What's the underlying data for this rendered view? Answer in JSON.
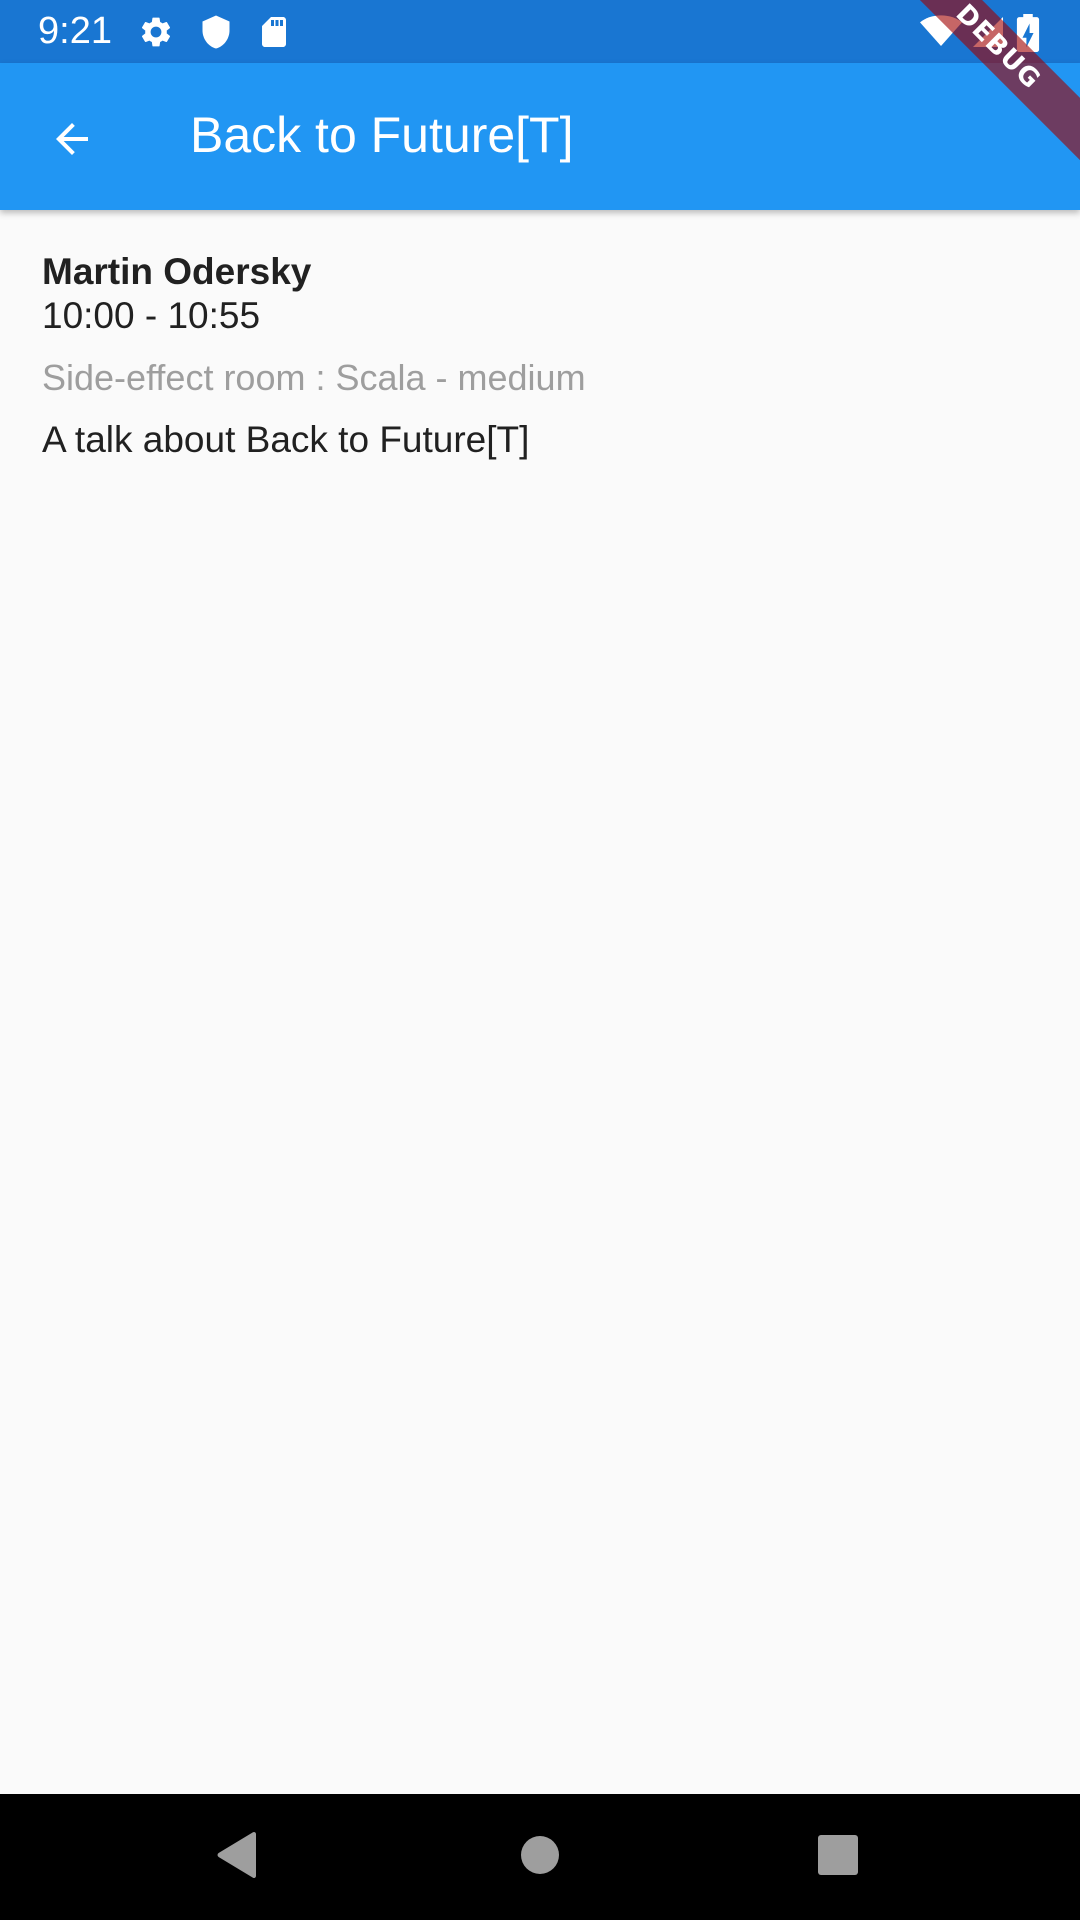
{
  "status_bar": {
    "time": "9:21",
    "left_icons": [
      "gear-icon",
      "shield-icon",
      "sd-card-icon"
    ],
    "right_icons": [
      "wifi-icon",
      "cell-signal-icon",
      "battery-charging-icon"
    ],
    "color": "#1976d2"
  },
  "app_bar": {
    "title": "Back to Future[T]",
    "back_icon": "arrow-back-icon",
    "color": "#2196f3"
  },
  "debug_banner": {
    "label": "DEBUG"
  },
  "talk": {
    "speaker": "Martin Odersky",
    "time": "10:00 - 10:55",
    "room": "Side-effect room : Scala - medium",
    "description": "A talk about Back to Future[T]"
  },
  "nav_bar": {
    "buttons": [
      "back-triangle-icon",
      "home-circle-icon",
      "recents-square-icon"
    ]
  }
}
